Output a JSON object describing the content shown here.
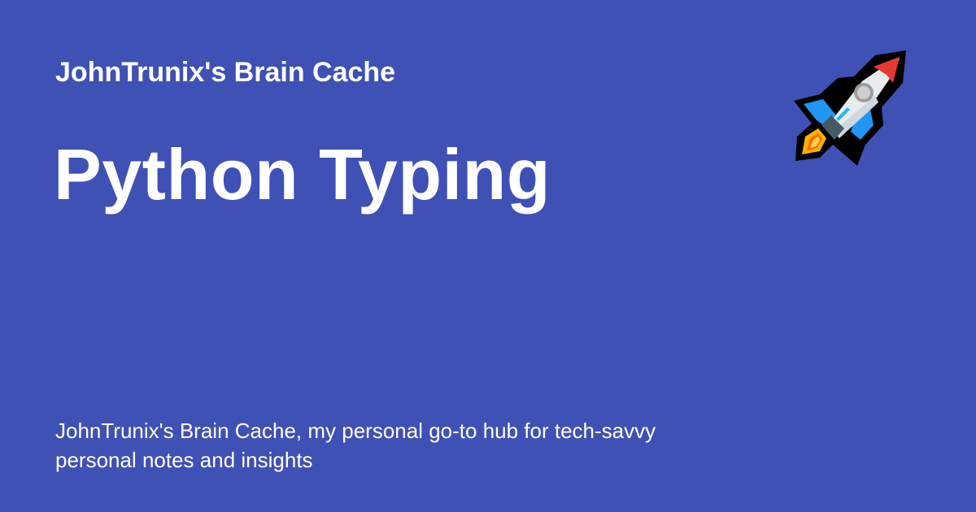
{
  "brand": {
    "site_name": "JohnTrunix's Brain Cache"
  },
  "page": {
    "title": "Python Typing",
    "description": "JohnTrunix's Brain Cache, my personal go-to hub for tech-savvy personal notes and insights"
  },
  "theme": {
    "background_color": "#3f51b5",
    "text_color": "#ffffff"
  },
  "icon": {
    "name": "rocket-icon",
    "style": "emoji"
  }
}
